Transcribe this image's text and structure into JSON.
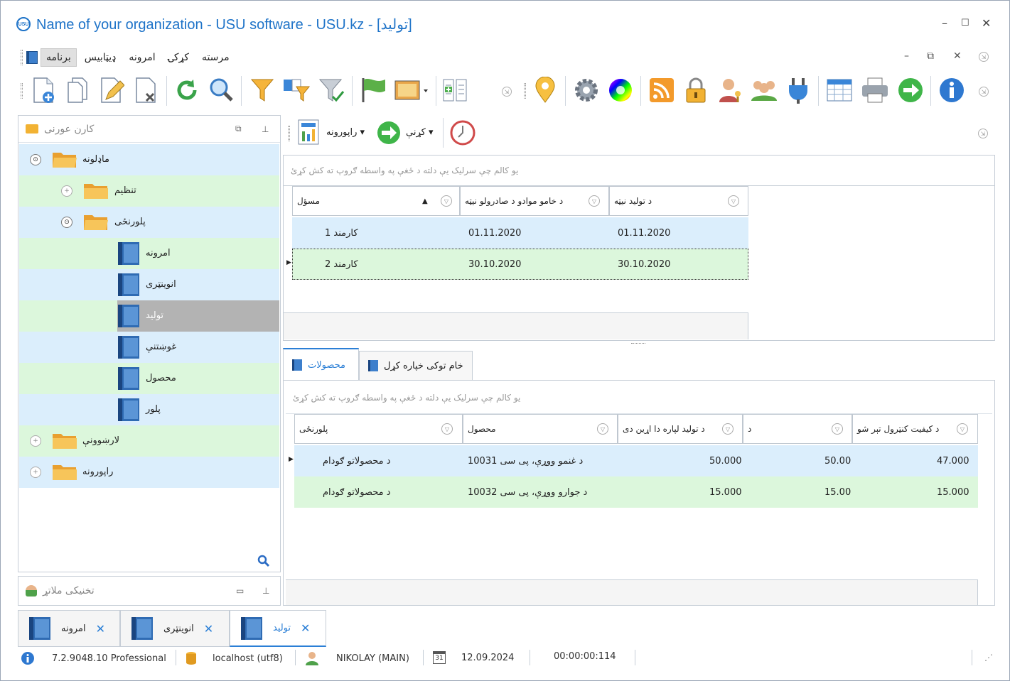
{
  "window": {
    "title": "Name of your organization - USU software - USU.kz - [تولید]",
    "logo_text": "USU",
    "controls": [
      "–",
      "☐",
      "✕"
    ]
  },
  "menu": {
    "items": [
      "مرسته",
      "کړکۍ",
      "امرونه",
      "ډیټابیس",
      "برنامه"
    ]
  },
  "left_panel": {
    "title": "کارن عورنی",
    "tree": [
      {
        "label": "ماډلونه",
        "type": "folder",
        "level": 0,
        "expanded": true
      },
      {
        "label": "تنظیم",
        "type": "folder",
        "level": 1,
        "expanded": false
      },
      {
        "label": "پلورنځی",
        "type": "folder",
        "level": 1,
        "expanded": true
      },
      {
        "label": "امرونه",
        "type": "book",
        "level": 2
      },
      {
        "label": "انوینټری",
        "type": "book",
        "level": 2
      },
      {
        "label": "تولید",
        "type": "book",
        "level": 2,
        "selected": true
      },
      {
        "label": "غوښتنې",
        "type": "book",
        "level": 2
      },
      {
        "label": "محصول",
        "type": "book",
        "level": 2
      },
      {
        "label": "پلور",
        "type": "book",
        "level": 2
      },
      {
        "label": "لارښوونې",
        "type": "folder",
        "level": 0,
        "expanded": false
      },
      {
        "label": "راپورونه",
        "type": "folder",
        "level": 0,
        "expanded": false
      }
    ],
    "bottom_panel_title": "تخنیکی ملاتړ"
  },
  "right_toolbar": {
    "report_label": "راپورونه",
    "action_label": "کړنې"
  },
  "group_hint": "یو کالم چې سرلیک یې دلته د ځغې په واسطه ګروپ ته کش کړئ",
  "grid1": {
    "headers": [
      "مسؤل",
      "د خامو موادو د صادرولو نیټه",
      "د تولید نیټه"
    ],
    "rows": [
      [
        "کارمند 1",
        "01.11.2020",
        "01.11.2020"
      ],
      [
        "کارمند 2",
        "30.10.2020",
        "30.10.2020"
      ]
    ]
  },
  "tabs2": {
    "active": "محصولات",
    "other": "خام توکی خپاره کړل"
  },
  "grid2": {
    "group_hint": "یو کالم چې سرلیک یې دلته د ځغې په واسطه ګروپ ته کش کړئ",
    "headers": [
      "پلورنځی",
      "محصول",
      "د تولید لپاره دا اړین دی",
      "د",
      "د کیفیت کنټرول تېر شو"
    ],
    "rows": [
      [
        "د محصولاتو ګودام",
        "د غنمو ووړې، پی سی 10031",
        "50.000",
        "50.00",
        "47.000"
      ],
      [
        "د محصولاتو ګودام",
        "د جوارو ووړې، پی سی 10032",
        "15.000",
        "15.00",
        "15.000"
      ]
    ]
  },
  "doc_tabs": [
    {
      "label": "امرونه",
      "active": false
    },
    {
      "label": "انوینټری",
      "active": false
    },
    {
      "label": "تولید",
      "active": true
    }
  ],
  "status": {
    "version": "7.2.9048.10 Professional",
    "db": "localhost (utf8)",
    "user": "NIKOLAY (MAIN)",
    "date_icon": "31",
    "date": "12.09.2024",
    "timer": "00:00:00:114"
  }
}
